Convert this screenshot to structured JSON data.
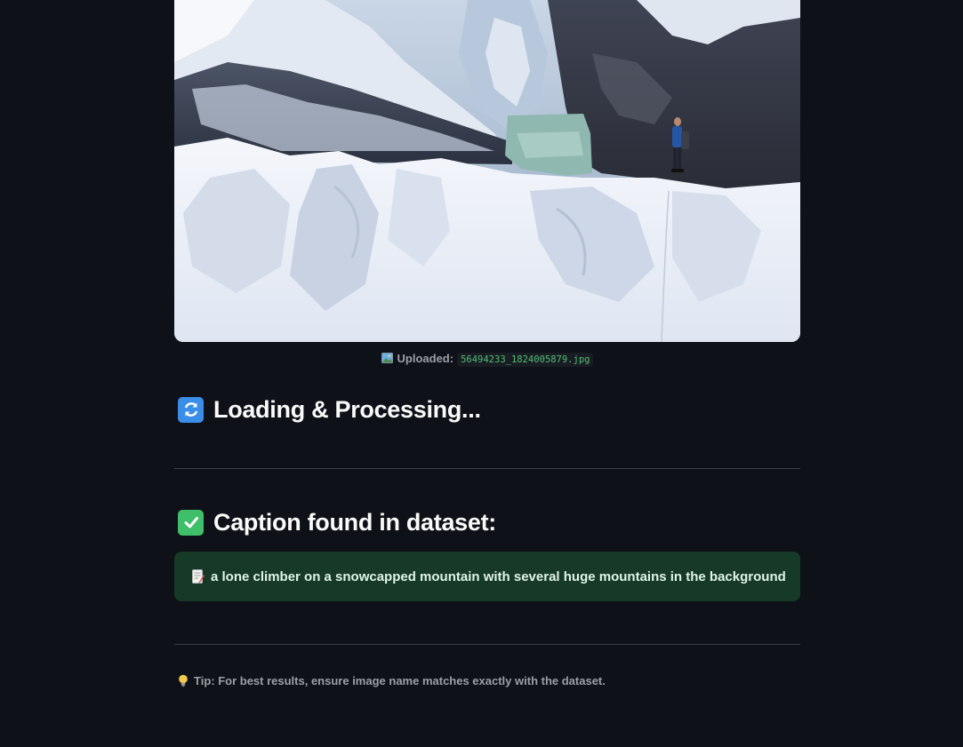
{
  "upload": {
    "label": "Uploaded:",
    "filename": "56494233_1824005879.jpg",
    "icon": "picture-icon"
  },
  "loading": {
    "title": "Loading & Processing...",
    "icon": "refresh-icon"
  },
  "result": {
    "title": "Caption found in dataset:",
    "icon": "check-icon",
    "caption": "a lone climber on a snowcapped mountain with several huge mountains in the background",
    "caption_icon": "memo-icon"
  },
  "tip": {
    "text": "Tip: For best results, ensure image name matches exactly with the dataset.",
    "icon": "lightbulb-icon"
  },
  "colors": {
    "background": "#0e1117",
    "success_bg": "#173928",
    "code_text": "#4fbf73",
    "divider": "#3a3d46"
  }
}
